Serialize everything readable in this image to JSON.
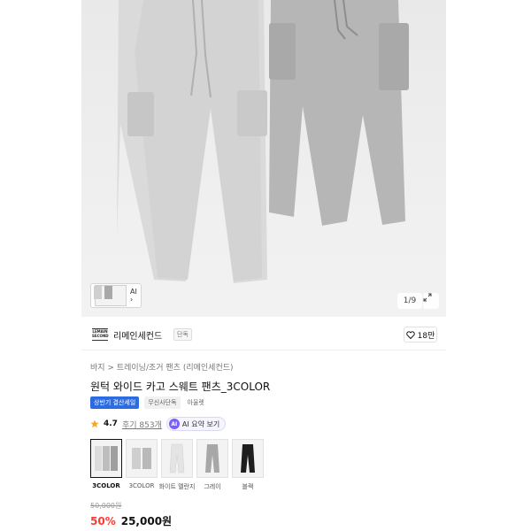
{
  "gallery": {
    "thumb_label": "AI",
    "thumb_arrow": "›",
    "counter": "1/9",
    "expand_icon": "expand-icon"
  },
  "brand": {
    "logo_text": "LEMAIN SECOND",
    "name": "리메인세컨드",
    "tag": "단독",
    "likes": "18만"
  },
  "breadcrumb": "바지 > 트레이닝/조거 팬츠 (리메인세컨드)",
  "product": {
    "title": "원턱 와이드 카고 스웨트 팬츠_3COLOR",
    "badges": {
      "sale": "상반기 결산세일",
      "exclusive": "무신사단독",
      "outlet": "아울렛"
    },
    "rating": "4.7",
    "reviews": "후기 853개",
    "ai_summary": "AI 요약 보기",
    "ai_icon_text": "AI"
  },
  "options": [
    {
      "label": "3COLOR",
      "shade": "#bdbdbd",
      "selected": true
    },
    {
      "label": "3COLOR",
      "shade": "#c9c9c9",
      "selected": false
    },
    {
      "label": "화이트 멜란지",
      "shade": "#e4e4e4",
      "selected": false
    },
    {
      "label": "그레이",
      "shade": "#a7a7a7",
      "selected": false
    },
    {
      "label": "블랙",
      "shade": "#1e1e1e",
      "selected": false
    }
  ],
  "pricing": {
    "original": "50,000원",
    "discount": "50%",
    "price": "25,000원"
  },
  "colors": {
    "sale_badge": "#2d6cdf",
    "discount": "#ff3b30",
    "star": "#f5a623"
  }
}
